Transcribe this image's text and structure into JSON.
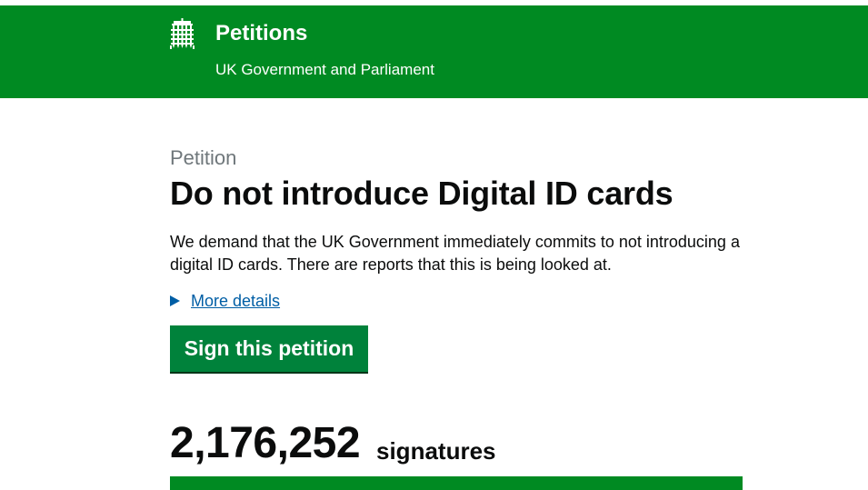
{
  "header": {
    "title": "Petitions",
    "subtitle": "UK Government and Parliament",
    "logo_icon": "portcullis-icon",
    "background_color": "#008a22"
  },
  "petition": {
    "caption": "Petition",
    "title": "Do not introduce Digital ID cards",
    "summary": "We demand that the UK Government immediately commits to not introducing a digital ID cards. There are reports that this is being looked at.",
    "more_details_label": "More details",
    "sign_button_label": "Sign this petition",
    "sign_button_color": "#00823b",
    "link_color": "#005ea5"
  },
  "signatures": {
    "count": "2,176,252",
    "label": "signatures",
    "progress_fraction": 1.0
  }
}
